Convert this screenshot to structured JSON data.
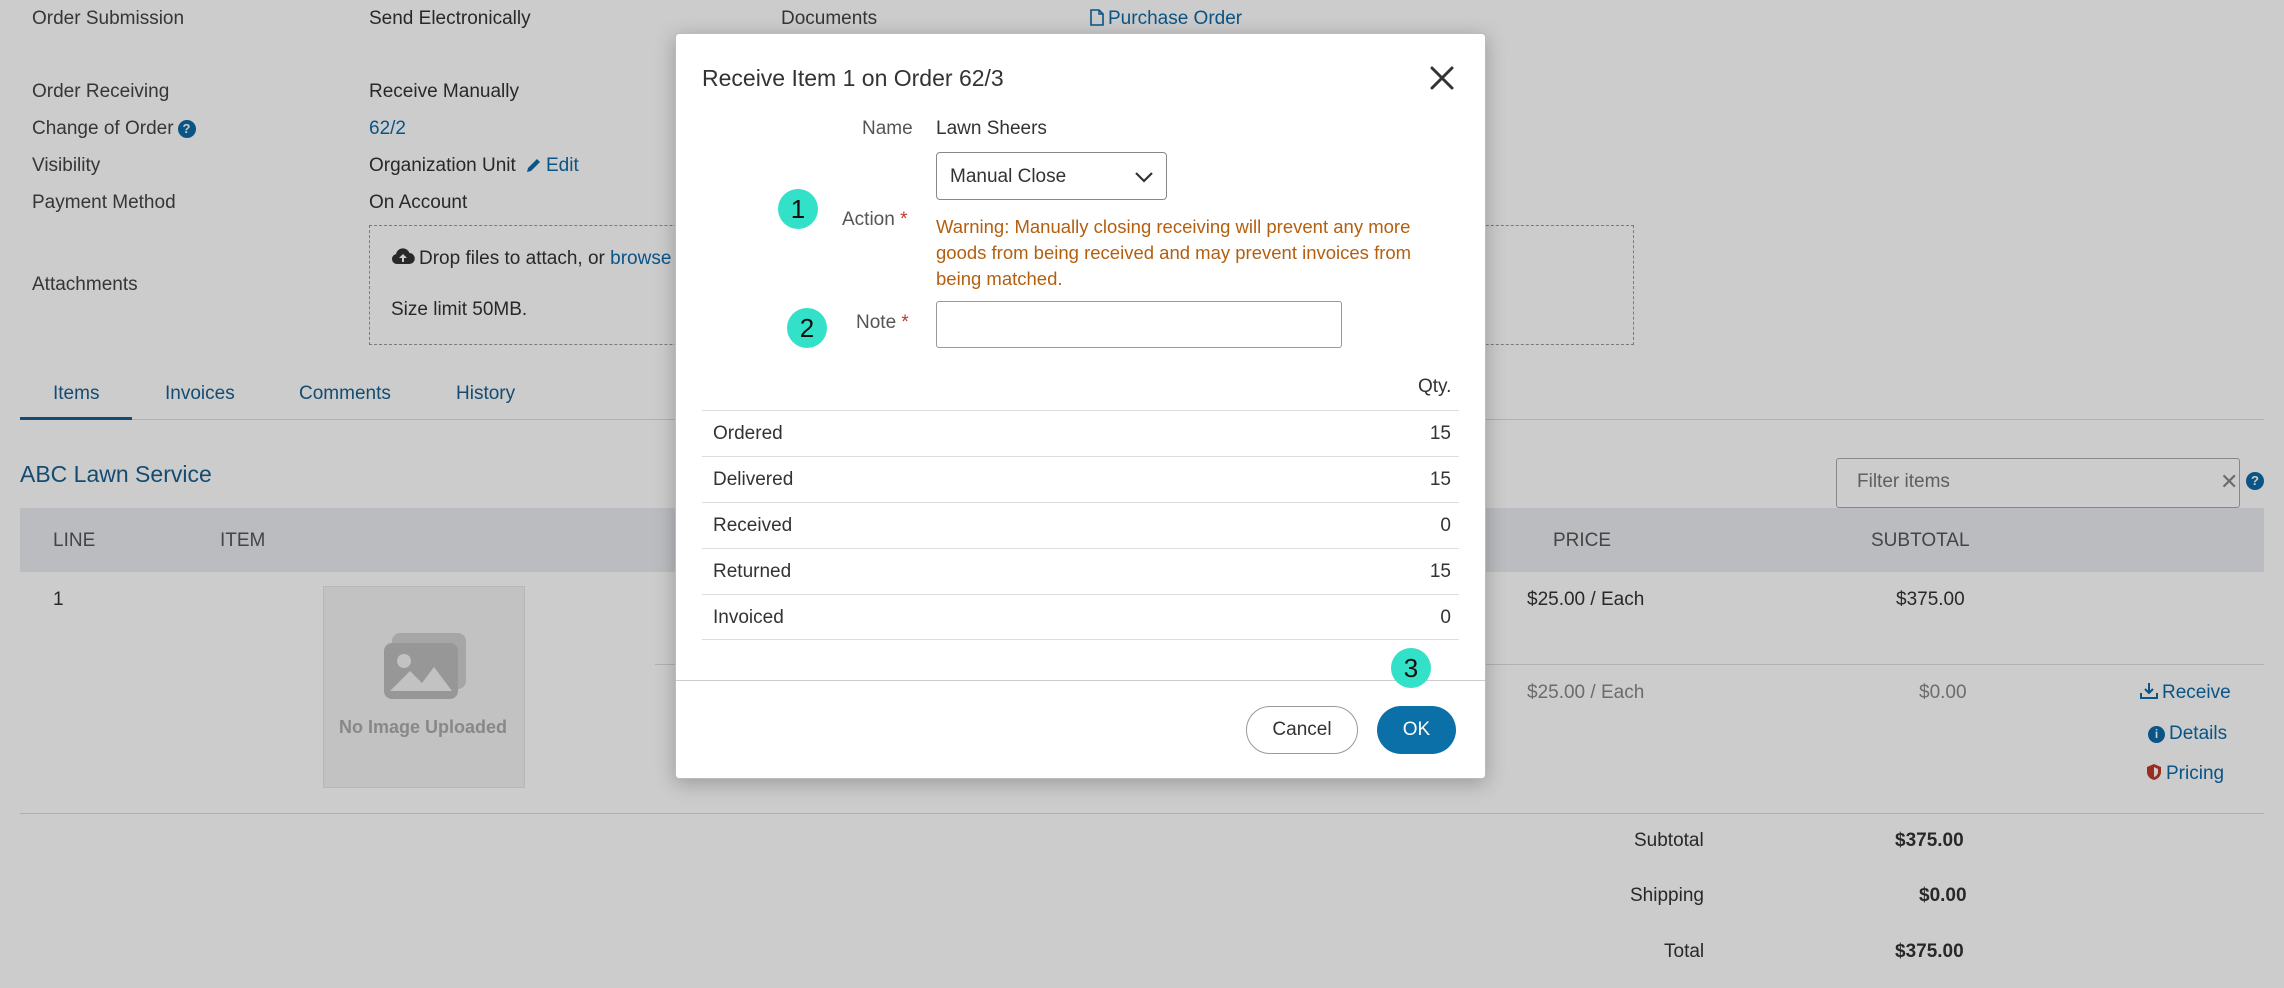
{
  "details": {
    "order_submission_label": "Order Submission",
    "order_submission_value": "Send Electronically",
    "documents_label": "Documents",
    "documents_link": "Purchase Order",
    "order_receiving_label": "Order Receiving",
    "order_receiving_value": "Receive Manually",
    "change_of_order_label": "Change of Order",
    "change_of_order_value": "62/2",
    "visibility_label": "Visibility",
    "visibility_value": "Organization Unit",
    "edit_label": "Edit",
    "payment_method_label": "Payment Method",
    "payment_method_value": "On Account",
    "attachments_label": "Attachments",
    "drop_text": "Drop files to attach, or",
    "browse_link": "browse",
    "size_limit": "Size limit 50MB."
  },
  "tabs": [
    "Items",
    "Invoices",
    "Comments",
    "History"
  ],
  "supplier": "ABC Lawn Service",
  "filter": {
    "placeholder": "Filter items"
  },
  "table": {
    "headers": {
      "line": "LINE",
      "item": "ITEM",
      "price": "PRICE",
      "subtotal": "SUBTOTAL"
    },
    "row": {
      "line": "1",
      "image_text": "No Image Uploaded",
      "price": "$25.00 / Each",
      "subtotal": "$375.00",
      "sub_price": "$25.00 / Each",
      "sub_subtotal": "$0.00"
    },
    "actions": {
      "receive": "Receive",
      "details": "Details",
      "pricing": "Pricing"
    }
  },
  "totals": {
    "subtotal_label": "Subtotal",
    "subtotal_value": "$375.00",
    "shipping_label": "Shipping",
    "shipping_value": "$0.00",
    "total_label": "Total",
    "total_value": "$375.00"
  },
  "modal": {
    "title": "Receive Item 1 on Order 62/3",
    "name_label": "Name",
    "name_value": "Lawn Sheers",
    "action_label": "Action",
    "action_value": "Manual Close",
    "warning": "Warning: Manually closing receiving will prevent any more goods from being received and may prevent invoices from being matched.",
    "note_label": "Note",
    "note_value": "",
    "required_mark": "*",
    "qty_header": "Qty.",
    "qty_rows": [
      {
        "label": "Ordered",
        "value": "15"
      },
      {
        "label": "Delivered",
        "value": "15"
      },
      {
        "label": "Received",
        "value": "0"
      },
      {
        "label": "Returned",
        "value": "15"
      },
      {
        "label": "Invoiced",
        "value": "0"
      }
    ],
    "cancel_label": "Cancel",
    "ok_label": "OK"
  },
  "markers": [
    "1",
    "2",
    "3"
  ],
  "colors": {
    "accent": "#0b6fa8",
    "warning": "#b35f10",
    "marker": "#33e0c8"
  }
}
